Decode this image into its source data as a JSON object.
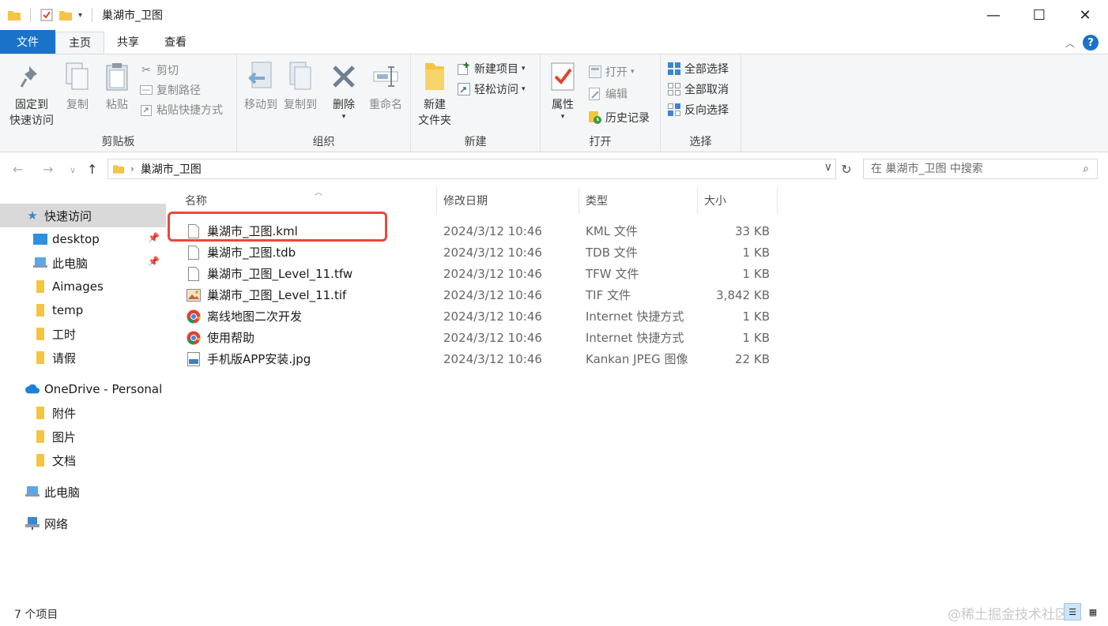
{
  "window": {
    "title": "巢湖市_卫图",
    "minimize": "—",
    "maximize": "☐",
    "close": "✕"
  },
  "ribbon_tabs": [
    "文件",
    "主页",
    "共享",
    "查看"
  ],
  "ribbon": {
    "clipboard": {
      "label": "剪贴板",
      "pin": "固定到\n快速访问",
      "pin_line1": "固定到",
      "pin_line2": "快速访问",
      "copy": "复制",
      "paste": "粘贴",
      "cut": "剪切",
      "copy_path": "复制路径",
      "paste_shortcut": "粘贴快捷方式"
    },
    "organize": {
      "label": "组织",
      "move_to": "移动到",
      "copy_to": "复制到",
      "delete": "删除",
      "rename": "重命名"
    },
    "new": {
      "label": "新建",
      "new_folder_line1": "新建",
      "new_folder_line2": "文件夹",
      "new_item": "新建项目",
      "easy_access": "轻松访问"
    },
    "open": {
      "label": "打开",
      "properties": "属性",
      "open": "打开",
      "edit": "编辑",
      "history": "历史记录"
    },
    "select": {
      "label": "选择",
      "select_all": "全部选择",
      "select_none": "全部取消",
      "invert": "反向选择"
    }
  },
  "address": {
    "path": "巢湖市_卫图",
    "search_placeholder": "在 巢湖市_卫图 中搜索"
  },
  "sidebar": {
    "quick_access": "快速访问",
    "items": [
      {
        "label": "desktop",
        "icon": "desktop-icon",
        "pinned": true
      },
      {
        "label": "此电脑",
        "icon": "computer-icon",
        "pinned": true
      },
      {
        "label": "Aimages",
        "icon": "folder-icon",
        "pinned": false
      },
      {
        "label": "temp",
        "icon": "folder-icon",
        "pinned": false
      },
      {
        "label": "工时",
        "icon": "folder-icon",
        "pinned": false
      },
      {
        "label": "请假",
        "icon": "folder-icon",
        "pinned": false
      }
    ],
    "onedrive": "OneDrive - Personal",
    "onedrive_items": [
      "附件",
      "图片",
      "文档"
    ],
    "this_pc": "此电脑",
    "network": "网络"
  },
  "columns": {
    "name": "名称",
    "modified": "修改日期",
    "type": "类型",
    "size": "大小"
  },
  "files": [
    {
      "name": "巢湖市_卫图.kml",
      "modified": "2024/3/12 10:46",
      "type": "KML 文件",
      "size": "33 KB",
      "icon": "blank-file-icon"
    },
    {
      "name": "巢湖市_卫图.tdb",
      "modified": "2024/3/12 10:46",
      "type": "TDB 文件",
      "size": "1 KB",
      "icon": "blank-file-icon"
    },
    {
      "name": "巢湖市_卫图_Level_11.tfw",
      "modified": "2024/3/12 10:46",
      "type": "TFW 文件",
      "size": "1 KB",
      "icon": "blank-file-icon"
    },
    {
      "name": "巢湖市_卫图_Level_11.tif",
      "modified": "2024/3/12 10:46",
      "type": "TIF 文件",
      "size": "3,842 KB",
      "icon": "image-file-icon"
    },
    {
      "name": "离线地图二次开发",
      "modified": "2024/3/12 10:46",
      "type": "Internet 快捷方式",
      "size": "1 KB",
      "icon": "chrome-icon"
    },
    {
      "name": "使用帮助",
      "modified": "2024/3/12 10:46",
      "type": "Internet 快捷方式",
      "size": "1 KB",
      "icon": "chrome-icon"
    },
    {
      "name": "手机版APP安装.jpg",
      "modified": "2024/3/12 10:46",
      "type": "Kankan JPEG 图像",
      "size": "22 KB",
      "icon": "jpg-file-icon"
    }
  ],
  "status": {
    "count": "7 个项目"
  },
  "watermark": "@稀土掘金技术社区",
  "colors": {
    "accent": "#1a73c9",
    "highlight_box": "#e8473f",
    "folder": "#f4c542"
  }
}
